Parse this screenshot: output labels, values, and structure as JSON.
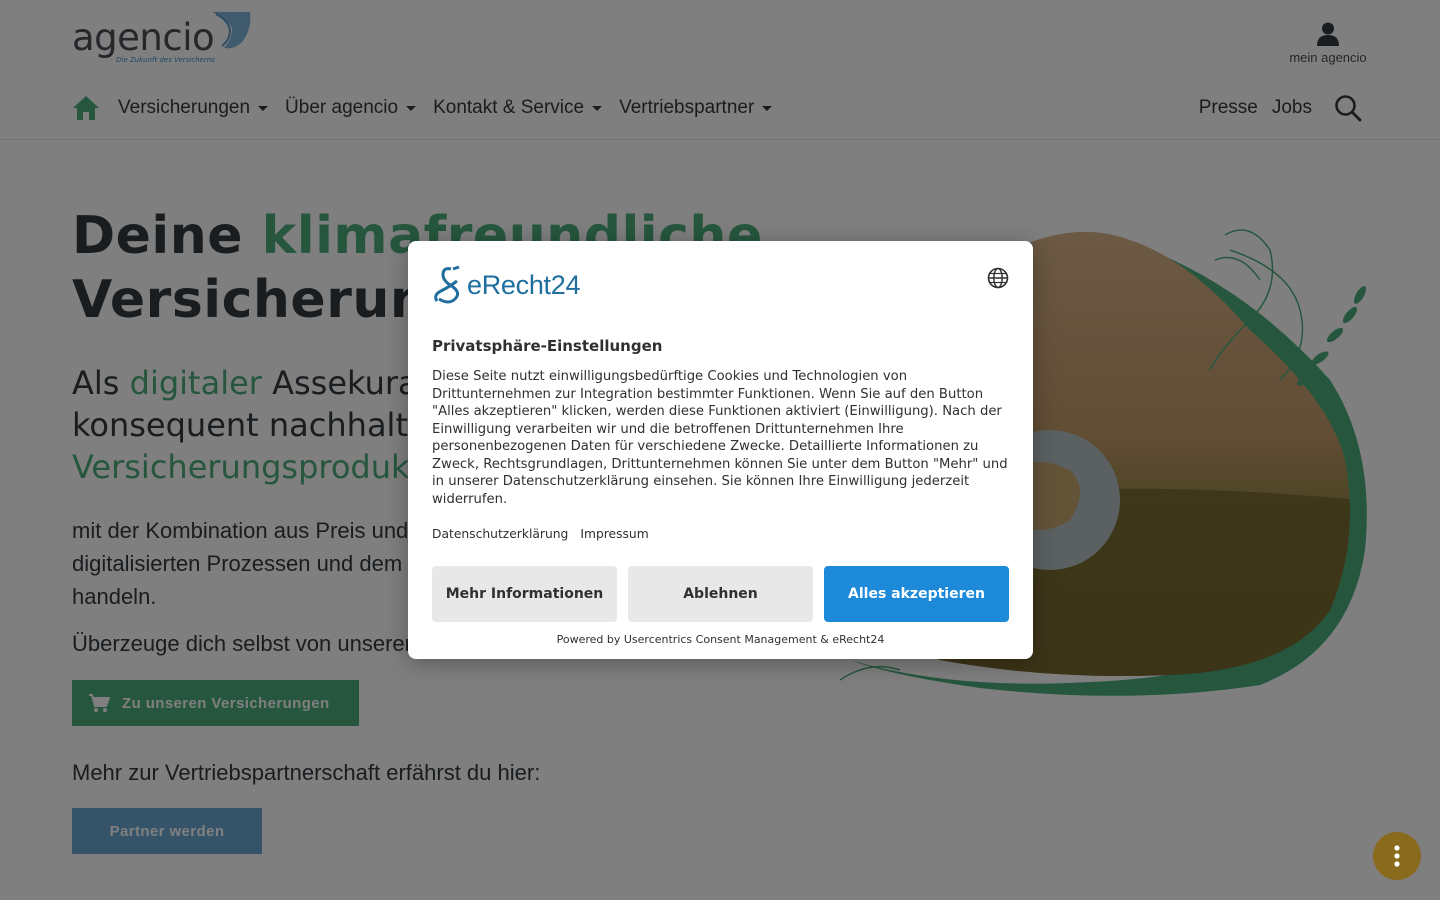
{
  "header": {
    "logo": {
      "name": "agencio",
      "tagline": "Die Zukunft des Versicherns"
    },
    "account_label": "mein agencio",
    "nav_items": [
      {
        "label": "Versicherungen"
      },
      {
        "label": "Über agencio"
      },
      {
        "label": "Kontakt & Service"
      },
      {
        "label": "Vertriebspartner"
      }
    ],
    "nav_right": [
      {
        "label": "Presse"
      },
      {
        "label": "Jobs"
      }
    ]
  },
  "hero": {
    "title_prefix": "Deine ",
    "title_accent": "klimafreundliche",
    "title_line2": "Versicherung",
    "sub_prefix": "Als ",
    "sub_accent": "digitaler",
    "sub_rest": " Assekura",
    "sub_line2": "konsequent nachhalti",
    "sub_line3_accent": "Versicherungsproduk",
    "body_line1": "mit der Kombination aus Preis und",
    "body_line2": "digitalisierten Prozessen und dem g",
    "body_line3": "handeln.",
    "proof_text": "Überzeuge dich selbst von unseren",
    "products_button": "Zu unseren Versicherungen",
    "partner_text": "Mehr zur Vertriebspartnerschaft erfährst du hier:",
    "partner_button": "Partner werden"
  },
  "consent": {
    "logo_text": "eRecht24",
    "title": "Privatsphäre-Einstellungen",
    "text": "Diese Seite nutzt einwilligungsbedürftige Cookies und Technologien von Drittunternehmen zur Integration bestimmter Funktionen. Wenn Sie auf den Button \"Alles akzeptieren\" klicken, werden diese Funktionen aktiviert (Einwilligung). Nach der Einwilligung verarbeiten wir und die betroffenen Drittunternehmen Ihre personenbezogenen Daten für verschiedene Zwecke. Detaillierte Informationen zu Zweck, Rechtsgrundlagen, Drittunternehmen können Sie unter dem Button \"Mehr\" und in unserer Datenschutzerklärung einsehen. Sie können Ihre Einwilligung jederzeit widerrufen.",
    "links": [
      {
        "label": "Datenschutzerklärung"
      },
      {
        "label": "Impressum"
      }
    ],
    "buttons": {
      "more": "Mehr Informationen",
      "deny": "Ablehnen",
      "accept": "Alles akzeptieren"
    },
    "footer": "Powered by Usercentrics Consent Management & eRecht24"
  },
  "colors": {
    "brand_green": "#4caf7d",
    "partner_blue": "#6aa9d3",
    "accept_blue": "#1c8ad8",
    "overlay": "rgba(0,0,0,0.5)",
    "fab": "#8a6a1c"
  },
  "icons": [
    "home-icon",
    "user-icon",
    "search-icon",
    "cart-icon",
    "globe-icon",
    "more-vertical-icon"
  ]
}
